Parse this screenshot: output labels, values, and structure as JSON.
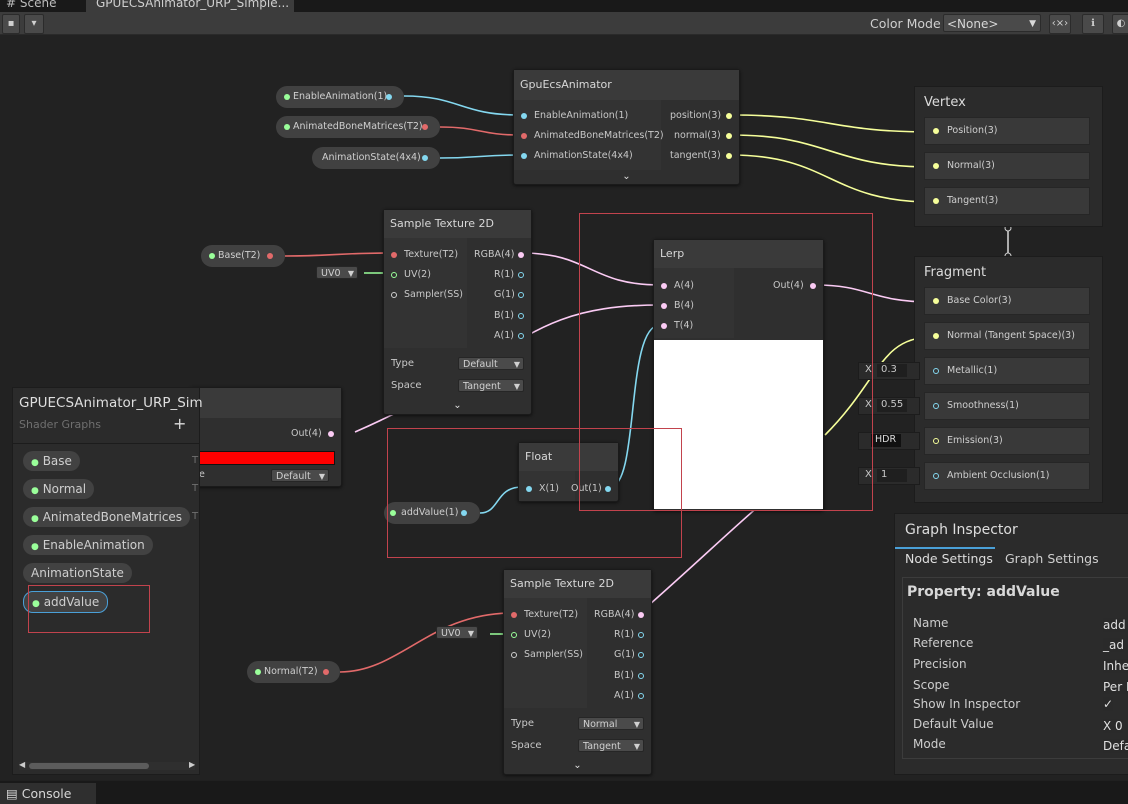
{
  "tabs": [
    "# Scene",
    "GPUECSAnimator_URP_Simple..."
  ],
  "toolbar": {
    "color_mode_label": "Color Mode",
    "color_mode_value": "<None>"
  },
  "property_nodes": {
    "enable": "EnableAnimation(1)",
    "bones": "AnimatedBoneMatrices(T2)",
    "state": "AnimationState(4x4)",
    "base": "Base(T2)",
    "addvalue": "addValue(1)",
    "normal": "Normal(T2)"
  },
  "animator_node": {
    "title": "GpuEcsAnimator",
    "inputs": [
      "EnableAnimation(1)",
      "AnimatedBoneMatrices(T2)",
      "AnimationState(4x4)"
    ],
    "outputs": [
      "position(3)",
      "normal(3)",
      "tangent(3)"
    ]
  },
  "sample1": {
    "title": "Sample Texture 2D",
    "inputs": [
      "Texture(T2)",
      "UV(2)",
      "Sampler(SS)"
    ],
    "outputs": [
      "RGBA(4)",
      "R(1)",
      "G(1)",
      "B(1)",
      "A(1)"
    ],
    "uv": "UV0",
    "type_label": "Type",
    "type_value": "Default",
    "space_label": "Space",
    "space_value": "Tangent"
  },
  "sample2": {
    "title": "Sample Texture 2D",
    "inputs": [
      "Texture(T2)",
      "UV(2)",
      "Sampler(SS)"
    ],
    "outputs": [
      "RGBA(4)",
      "R(1)",
      "G(1)",
      "B(1)",
      "A(1)"
    ],
    "uv": "UV0",
    "type_label": "Type",
    "type_value": "Normal",
    "space_label": "Space",
    "space_value": "Tangent"
  },
  "lerp_node": {
    "title": "Lerp",
    "inputs": [
      "A(4)",
      "B(4)",
      "T(4)"
    ],
    "output": "Out(4)"
  },
  "float_node": {
    "title": "Float",
    "input": "X(1)",
    "output": "Out(1)"
  },
  "color_node": {
    "output": "Out(4)",
    "mode_value": "Default",
    "cut_label": "e",
    "t_mark": "T"
  },
  "vertex": {
    "title": "Vertex",
    "slots": [
      "Position(3)",
      "Normal(3)",
      "Tangent(3)"
    ]
  },
  "fragment": {
    "title": "Fragment",
    "slots": [
      "Base Color(3)",
      "Normal (Tangent Space)(3)",
      "Metallic(1)",
      "Smoothness(1)",
      "Emission(3)",
      "Ambient Occlusion(1)"
    ],
    "metallic_x": "0.3",
    "smooth_x": "0.55",
    "hdr": "HDR",
    "ao_x": "1",
    "x": "X"
  },
  "blackboard": {
    "title": "GPUECSAnimator_URP_Sim",
    "subtitle": "Shader Graphs",
    "add": "+",
    "properties": [
      "Base",
      "Normal",
      "AnimatedBoneMatrices",
      "EnableAnimation",
      "AnimationState",
      "addValue"
    ],
    "side_marks": [
      "T",
      "T",
      "T"
    ]
  },
  "inspector": {
    "title": "Graph Inspector",
    "tabs": [
      "Node Settings",
      "Graph Settings"
    ],
    "property_title": "Property: addValue",
    "rows": [
      {
        "label": "Name",
        "value": "add"
      },
      {
        "label": "Reference",
        "value": "_ad"
      },
      {
        "label": "Precision",
        "value": "Inhe"
      },
      {
        "label": "Scope",
        "value": "Per I"
      },
      {
        "label": "Show In Inspector",
        "value": "✓"
      },
      {
        "label": "Default Value",
        "value": "X  0"
      },
      {
        "label": "Mode",
        "value": "Defa"
      }
    ]
  },
  "console": {
    "label": "Console"
  },
  "colors": {
    "texture": "#e26a6a",
    "float": "#84d8f0",
    "vector3": "#f6ff9a",
    "vector4": "#fbcbf4",
    "highlight": "#c2434d"
  }
}
